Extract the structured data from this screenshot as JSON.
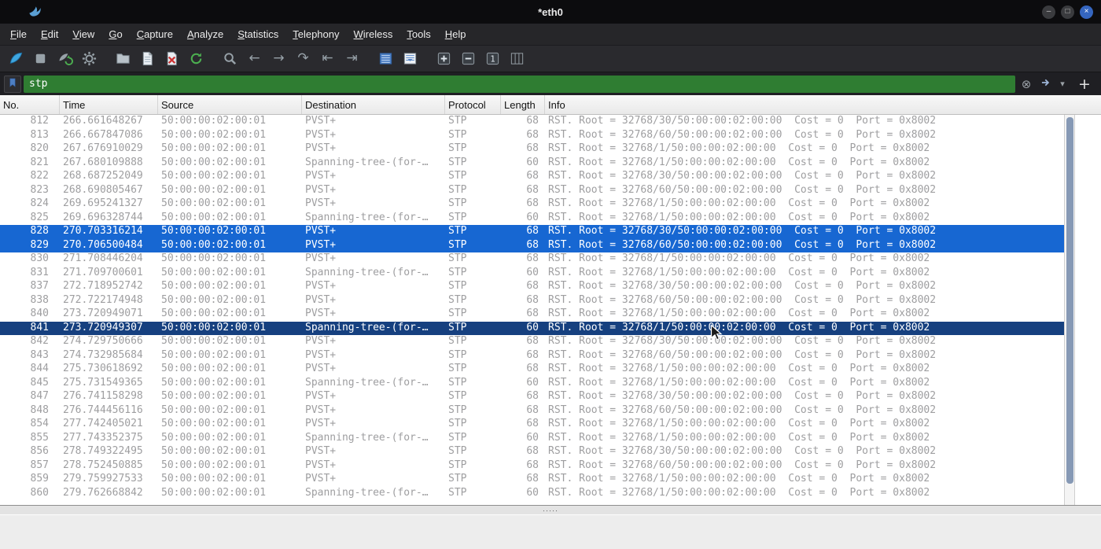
{
  "window": {
    "title": "*eth0",
    "controls": [
      {
        "name": "minimize-button",
        "glyph": "–"
      },
      {
        "name": "maximize-button",
        "glyph": "□"
      },
      {
        "name": "close-button",
        "glyph": "×"
      }
    ]
  },
  "menu": {
    "items": [
      "File",
      "Edit",
      "View",
      "Go",
      "Capture",
      "Analyze",
      "Statistics",
      "Telephony",
      "Wireless",
      "Tools",
      "Help"
    ]
  },
  "toolbar": {
    "buttons": [
      {
        "name": "start-capture",
        "group": 1
      },
      {
        "name": "stop-capture",
        "group": 1
      },
      {
        "name": "restart-capture",
        "group": 1
      },
      {
        "name": "capture-options",
        "group": 1
      },
      {
        "name": "open-capture-file",
        "group": 2
      },
      {
        "name": "save-capture-file",
        "group": 2
      },
      {
        "name": "close-capture-file",
        "group": 2
      },
      {
        "name": "reload-capture-file",
        "group": 2
      },
      {
        "name": "find-packet",
        "group": 3
      },
      {
        "name": "go-back",
        "group": 3
      },
      {
        "name": "go-forward",
        "group": 3
      },
      {
        "name": "go-to-packet",
        "group": 3
      },
      {
        "name": "go-first-packet",
        "group": 3
      },
      {
        "name": "go-last-packet",
        "group": 3
      },
      {
        "name": "colorize-packets",
        "group": 4
      },
      {
        "name": "auto-scroll",
        "group": 4
      },
      {
        "name": "zoom-in",
        "group": 5
      },
      {
        "name": "zoom-out",
        "group": 5
      },
      {
        "name": "zoom-original",
        "group": 5
      },
      {
        "name": "resize-columns",
        "group": 5
      }
    ]
  },
  "filter": {
    "value": "stp",
    "placeholder": "",
    "clear_glyph": "⊗",
    "dropdown_glyph": "▾",
    "add_glyph": "+"
  },
  "packet_list": {
    "columns": [
      "No.",
      "Time",
      "Source",
      "Destination",
      "Protocol",
      "Length",
      "Info"
    ],
    "rows": [
      {
        "no": "812",
        "time": "266.661648267",
        "source": "50:00:00:02:00:01",
        "destination": "PVST+",
        "protocol": "STP",
        "length": "68",
        "info": "RST. Root = 32768/30/50:00:00:02:00:00  Cost = 0  Port = 0x8002",
        "state": "normal"
      },
      {
        "no": "813",
        "time": "266.667847086",
        "source": "50:00:00:02:00:01",
        "destination": "PVST+",
        "protocol": "STP",
        "length": "68",
        "info": "RST. Root = 32768/60/50:00:00:02:00:00  Cost = 0  Port = 0x8002",
        "state": "normal"
      },
      {
        "no": "820",
        "time": "267.676910029",
        "source": "50:00:00:02:00:01",
        "destination": "PVST+",
        "protocol": "STP",
        "length": "68",
        "info": "RST. Root = 32768/1/50:00:00:02:00:00  Cost = 0  Port = 0x8002",
        "state": "normal"
      },
      {
        "no": "821",
        "time": "267.680109888",
        "source": "50:00:00:02:00:01",
        "destination": "Spanning-tree-(for-…",
        "protocol": "STP",
        "length": "60",
        "info": "RST. Root = 32768/1/50:00:00:02:00:00  Cost = 0  Port = 0x8002",
        "state": "normal"
      },
      {
        "no": "822",
        "time": "268.687252049",
        "source": "50:00:00:02:00:01",
        "destination": "PVST+",
        "protocol": "STP",
        "length": "68",
        "info": "RST. Root = 32768/30/50:00:00:02:00:00  Cost = 0  Port = 0x8002",
        "state": "normal"
      },
      {
        "no": "823",
        "time": "268.690805467",
        "source": "50:00:00:02:00:01",
        "destination": "PVST+",
        "protocol": "STP",
        "length": "68",
        "info": "RST. Root = 32768/60/50:00:00:02:00:00  Cost = 0  Port = 0x8002",
        "state": "normal"
      },
      {
        "no": "824",
        "time": "269.695241327",
        "source": "50:00:00:02:00:01",
        "destination": "PVST+",
        "protocol": "STP",
        "length": "68",
        "info": "RST. Root = 32768/1/50:00:00:02:00:00  Cost = 0  Port = 0x8002",
        "state": "normal"
      },
      {
        "no": "825",
        "time": "269.696328744",
        "source": "50:00:00:02:00:01",
        "destination": "Spanning-tree-(for-…",
        "protocol": "STP",
        "length": "60",
        "info": "RST. Root = 32768/1/50:00:00:02:00:00  Cost = 0  Port = 0x8002",
        "state": "normal"
      },
      {
        "no": "828",
        "time": "270.703316214",
        "source": "50:00:00:02:00:01",
        "destination": "PVST+",
        "protocol": "STP",
        "length": "68",
        "info": "RST. Root = 32768/30/50:00:00:02:00:00  Cost = 0  Port = 0x8002",
        "state": "selected"
      },
      {
        "no": "829",
        "time": "270.706500484",
        "source": "50:00:00:02:00:01",
        "destination": "PVST+",
        "protocol": "STP",
        "length": "68",
        "info": "RST. Root = 32768/60/50:00:00:02:00:00  Cost = 0  Port = 0x8002",
        "state": "selected"
      },
      {
        "no": "830",
        "time": "271.708446204",
        "source": "50:00:00:02:00:01",
        "destination": "PVST+",
        "protocol": "STP",
        "length": "68",
        "info": "RST. Root = 32768/1/50:00:00:02:00:00  Cost = 0  Port = 0x8002",
        "state": "normal"
      },
      {
        "no": "831",
        "time": "271.709700601",
        "source": "50:00:00:02:00:01",
        "destination": "Spanning-tree-(for-…",
        "protocol": "STP",
        "length": "60",
        "info": "RST. Root = 32768/1/50:00:00:02:00:00  Cost = 0  Port = 0x8002",
        "state": "normal"
      },
      {
        "no": "837",
        "time": "272.718952742",
        "source": "50:00:00:02:00:01",
        "destination": "PVST+",
        "protocol": "STP",
        "length": "68",
        "info": "RST. Root = 32768/30/50:00:00:02:00:00  Cost = 0  Port = 0x8002",
        "state": "normal"
      },
      {
        "no": "838",
        "time": "272.722174948",
        "source": "50:00:00:02:00:01",
        "destination": "PVST+",
        "protocol": "STP",
        "length": "68",
        "info": "RST. Root = 32768/60/50:00:00:02:00:00  Cost = 0  Port = 0x8002",
        "state": "normal"
      },
      {
        "no": "840",
        "time": "273.720949071",
        "source": "50:00:00:02:00:01",
        "destination": "PVST+",
        "protocol": "STP",
        "length": "68",
        "info": "RST. Root = 32768/1/50:00:00:02:00:00  Cost = 0  Port = 0x8002",
        "state": "normal"
      },
      {
        "no": "841",
        "time": "273.720949307",
        "source": "50:00:00:02:00:01",
        "destination": "Spanning-tree-(for-…",
        "protocol": "STP",
        "length": "60",
        "info": "RST. Root = 32768/1/50:00:00:02:00:00  Cost = 0  Port = 0x8002",
        "state": "focused"
      },
      {
        "no": "842",
        "time": "274.729750666",
        "source": "50:00:00:02:00:01",
        "destination": "PVST+",
        "protocol": "STP",
        "length": "68",
        "info": "RST. Root = 32768/30/50:00:00:02:00:00  Cost = 0  Port = 0x8002",
        "state": "normal"
      },
      {
        "no": "843",
        "time": "274.732985684",
        "source": "50:00:00:02:00:01",
        "destination": "PVST+",
        "protocol": "STP",
        "length": "68",
        "info": "RST. Root = 32768/60/50:00:00:02:00:00  Cost = 0  Port = 0x8002",
        "state": "normal"
      },
      {
        "no": "844",
        "time": "275.730618692",
        "source": "50:00:00:02:00:01",
        "destination": "PVST+",
        "protocol": "STP",
        "length": "68",
        "info": "RST. Root = 32768/1/50:00:00:02:00:00  Cost = 0  Port = 0x8002",
        "state": "normal"
      },
      {
        "no": "845",
        "time": "275.731549365",
        "source": "50:00:00:02:00:01",
        "destination": "Spanning-tree-(for-…",
        "protocol": "STP",
        "length": "60",
        "info": "RST. Root = 32768/1/50:00:00:02:00:00  Cost = 0  Port = 0x8002",
        "state": "normal"
      },
      {
        "no": "847",
        "time": "276.741158298",
        "source": "50:00:00:02:00:01",
        "destination": "PVST+",
        "protocol": "STP",
        "length": "68",
        "info": "RST. Root = 32768/30/50:00:00:02:00:00  Cost = 0  Port = 0x8002",
        "state": "normal"
      },
      {
        "no": "848",
        "time": "276.744456116",
        "source": "50:00:00:02:00:01",
        "destination": "PVST+",
        "protocol": "STP",
        "length": "68",
        "info": "RST. Root = 32768/60/50:00:00:02:00:00  Cost = 0  Port = 0x8002",
        "state": "normal"
      },
      {
        "no": "854",
        "time": "277.742405021",
        "source": "50:00:00:02:00:01",
        "destination": "PVST+",
        "protocol": "STP",
        "length": "68",
        "info": "RST. Root = 32768/1/50:00:00:02:00:00  Cost = 0  Port = 0x8002",
        "state": "normal"
      },
      {
        "no": "855",
        "time": "277.743352375",
        "source": "50:00:00:02:00:01",
        "destination": "Spanning-tree-(for-…",
        "protocol": "STP",
        "length": "60",
        "info": "RST. Root = 32768/1/50:00:00:02:00:00  Cost = 0  Port = 0x8002",
        "state": "normal"
      },
      {
        "no": "856",
        "time": "278.749322495",
        "source": "50:00:00:02:00:01",
        "destination": "PVST+",
        "protocol": "STP",
        "length": "68",
        "info": "RST. Root = 32768/30/50:00:00:02:00:00  Cost = 0  Port = 0x8002",
        "state": "normal"
      },
      {
        "no": "857",
        "time": "278.752450885",
        "source": "50:00:00:02:00:01",
        "destination": "PVST+",
        "protocol": "STP",
        "length": "68",
        "info": "RST. Root = 32768/60/50:00:00:02:00:00  Cost = 0  Port = 0x8002",
        "state": "normal"
      },
      {
        "no": "859",
        "time": "279.759927533",
        "source": "50:00:00:02:00:01",
        "destination": "PVST+",
        "protocol": "STP",
        "length": "68",
        "info": "RST. Root = 32768/1/50:00:00:02:00:00  Cost = 0  Port = 0x8002",
        "state": "normal"
      },
      {
        "no": "860",
        "time": "279.762668842",
        "source": "50:00:00:02:00:01",
        "destination": "Spanning-tree-(for-…",
        "protocol": "STP",
        "length": "60",
        "info": "RST. Root = 32768/1/50:00:00:02:00:00  Cost = 0  Port = 0x8002",
        "state": "normal"
      }
    ]
  },
  "splitter": {
    "handle_dots": "·····"
  },
  "colors": {
    "selected_row": "#1767d2",
    "focused_row": "#16407f",
    "filter_valid": "#2f7d32",
    "row_text": "#9e9ea0",
    "accent_blue": "#3ea6df"
  }
}
